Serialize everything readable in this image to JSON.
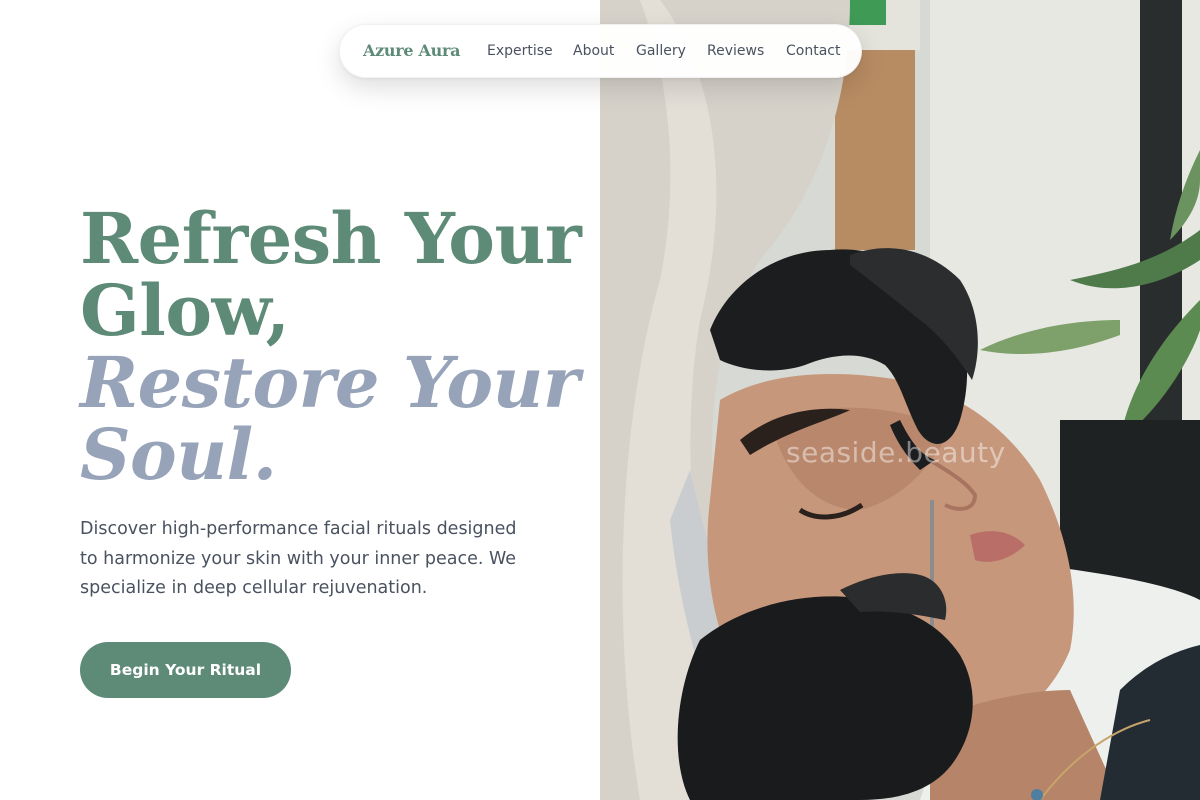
{
  "nav": {
    "brand": "Azure Aura",
    "links": [
      "Expertise",
      "About",
      "Gallery",
      "Reviews",
      "Contact"
    ]
  },
  "hero": {
    "headline": {
      "line1": "Refresh Your",
      "line2": "Glow,",
      "line3": "Restore Your",
      "line4": "Soul."
    },
    "description": "Discover high-performance facial rituals designed to harmonize your skin with your inner peace. We specialize in deep cellular rejuvenation.",
    "cta_label": "Begin Your Ritual"
  },
  "photo": {
    "watermark": "seaside.beauty"
  },
  "colors": {
    "brand_green": "#5e8a78",
    "accent_blue_gray": "#97a3b8",
    "body_text": "#4a5260"
  }
}
